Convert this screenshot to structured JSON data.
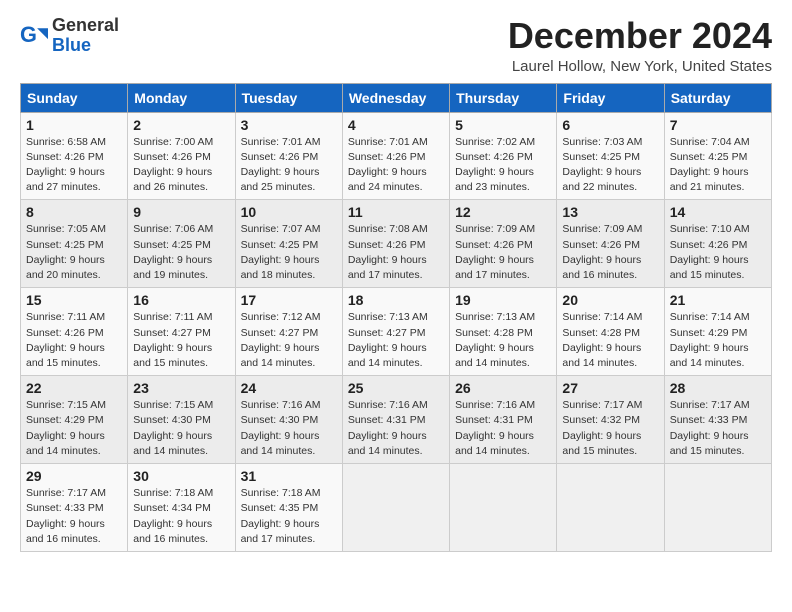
{
  "header": {
    "logo_general": "General",
    "logo_blue": "Blue",
    "title": "December 2024",
    "subtitle": "Laurel Hollow, New York, United States"
  },
  "columns": [
    "Sunday",
    "Monday",
    "Tuesday",
    "Wednesday",
    "Thursday",
    "Friday",
    "Saturday"
  ],
  "weeks": [
    [
      {
        "day": "1",
        "rise": "6:58 AM",
        "set": "4:26 PM",
        "daylight": "9 hours and 27 minutes."
      },
      {
        "day": "2",
        "rise": "7:00 AM",
        "set": "4:26 PM",
        "daylight": "9 hours and 26 minutes."
      },
      {
        "day": "3",
        "rise": "7:01 AM",
        "set": "4:26 PM",
        "daylight": "9 hours and 25 minutes."
      },
      {
        "day": "4",
        "rise": "7:01 AM",
        "set": "4:26 PM",
        "daylight": "9 hours and 24 minutes."
      },
      {
        "day": "5",
        "rise": "7:02 AM",
        "set": "4:26 PM",
        "daylight": "9 hours and 23 minutes."
      },
      {
        "day": "6",
        "rise": "7:03 AM",
        "set": "4:25 PM",
        "daylight": "9 hours and 22 minutes."
      },
      {
        "day": "7",
        "rise": "7:04 AM",
        "set": "4:25 PM",
        "daylight": "9 hours and 21 minutes."
      }
    ],
    [
      {
        "day": "8",
        "rise": "7:05 AM",
        "set": "4:25 PM",
        "daylight": "9 hours and 20 minutes."
      },
      {
        "day": "9",
        "rise": "7:06 AM",
        "set": "4:25 PM",
        "daylight": "9 hours and 19 minutes."
      },
      {
        "day": "10",
        "rise": "7:07 AM",
        "set": "4:25 PM",
        "daylight": "9 hours and 18 minutes."
      },
      {
        "day": "11",
        "rise": "7:08 AM",
        "set": "4:26 PM",
        "daylight": "9 hours and 17 minutes."
      },
      {
        "day": "12",
        "rise": "7:09 AM",
        "set": "4:26 PM",
        "daylight": "9 hours and 17 minutes."
      },
      {
        "day": "13",
        "rise": "7:09 AM",
        "set": "4:26 PM",
        "daylight": "9 hours and 16 minutes."
      },
      {
        "day": "14",
        "rise": "7:10 AM",
        "set": "4:26 PM",
        "daylight": "9 hours and 15 minutes."
      }
    ],
    [
      {
        "day": "15",
        "rise": "7:11 AM",
        "set": "4:26 PM",
        "daylight": "9 hours and 15 minutes."
      },
      {
        "day": "16",
        "rise": "7:11 AM",
        "set": "4:27 PM",
        "daylight": "9 hours and 15 minutes."
      },
      {
        "day": "17",
        "rise": "7:12 AM",
        "set": "4:27 PM",
        "daylight": "9 hours and 14 minutes."
      },
      {
        "day": "18",
        "rise": "7:13 AM",
        "set": "4:27 PM",
        "daylight": "9 hours and 14 minutes."
      },
      {
        "day": "19",
        "rise": "7:13 AM",
        "set": "4:28 PM",
        "daylight": "9 hours and 14 minutes."
      },
      {
        "day": "20",
        "rise": "7:14 AM",
        "set": "4:28 PM",
        "daylight": "9 hours and 14 minutes."
      },
      {
        "day": "21",
        "rise": "7:14 AM",
        "set": "4:29 PM",
        "daylight": "9 hours and 14 minutes."
      }
    ],
    [
      {
        "day": "22",
        "rise": "7:15 AM",
        "set": "4:29 PM",
        "daylight": "9 hours and 14 minutes."
      },
      {
        "day": "23",
        "rise": "7:15 AM",
        "set": "4:30 PM",
        "daylight": "9 hours and 14 minutes."
      },
      {
        "day": "24",
        "rise": "7:16 AM",
        "set": "4:30 PM",
        "daylight": "9 hours and 14 minutes."
      },
      {
        "day": "25",
        "rise": "7:16 AM",
        "set": "4:31 PM",
        "daylight": "9 hours and 14 minutes."
      },
      {
        "day": "26",
        "rise": "7:16 AM",
        "set": "4:31 PM",
        "daylight": "9 hours and 14 minutes."
      },
      {
        "day": "27",
        "rise": "7:17 AM",
        "set": "4:32 PM",
        "daylight": "9 hours and 15 minutes."
      },
      {
        "day": "28",
        "rise": "7:17 AM",
        "set": "4:33 PM",
        "daylight": "9 hours and 15 minutes."
      }
    ],
    [
      {
        "day": "29",
        "rise": "7:17 AM",
        "set": "4:33 PM",
        "daylight": "9 hours and 16 minutes."
      },
      {
        "day": "30",
        "rise": "7:18 AM",
        "set": "4:34 PM",
        "daylight": "9 hours and 16 minutes."
      },
      {
        "day": "31",
        "rise": "7:18 AM",
        "set": "4:35 PM",
        "daylight": "9 hours and 17 minutes."
      },
      null,
      null,
      null,
      null
    ]
  ],
  "labels": {
    "sunrise": "Sunrise:",
    "sunset": "Sunset:",
    "daylight": "Daylight:"
  }
}
